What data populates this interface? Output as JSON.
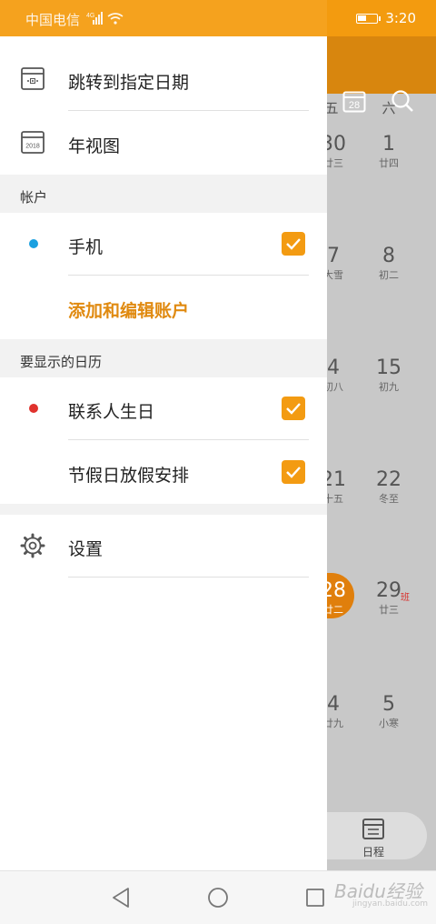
{
  "status_bar": {
    "carrier": "中国电信",
    "signal": "4G",
    "time": "3:20"
  },
  "calendar": {
    "weekdays": [
      "五",
      "六"
    ],
    "cells": [
      {
        "num": "30",
        "lunar": "廿三"
      },
      {
        "num": "1",
        "lunar": "廿四"
      },
      {
        "num": "7",
        "lunar": "大雪"
      },
      {
        "num": "8",
        "lunar": "初二"
      },
      {
        "num": "4",
        "lunar": "初八"
      },
      {
        "num": "15",
        "lunar": "初九"
      },
      {
        "num": "21",
        "lunar": "十五"
      },
      {
        "num": "22",
        "lunar": "冬至"
      },
      {
        "num": "28",
        "lunar": "廿二"
      },
      {
        "num": "29",
        "lunar": "廿三"
      },
      {
        "num": "4",
        "lunar": "廿九"
      },
      {
        "num": "5",
        "lunar": "小寒"
      }
    ],
    "badge": "班",
    "header_date_icon": "28",
    "bottom_tab_label": "日程"
  },
  "drawer": {
    "goto_date": "跳转到指定日期",
    "year_view": "年视图",
    "year_icon_text": "2018",
    "section_accounts": "帐户",
    "account_phone": "手机",
    "add_edit_accounts": "添加和编辑账户",
    "section_calendars": "要显示的日历",
    "cal_birthdays": "联系人生日",
    "cal_holidays": "节假日放假安排",
    "settings": "设置"
  },
  "colors": {
    "accent": "#f39b12",
    "phone_dot": "#1aa0e0",
    "birthday_dot": "#e0322d"
  },
  "watermark": {
    "main": "Baidu经验",
    "sub": "jingyan.baidu.com"
  },
  "icons": [
    "calendar-goto-icon",
    "year-view-icon",
    "gear-icon",
    "search-icon",
    "calendar-today-icon",
    "back-icon",
    "home-icon",
    "recents-icon"
  ]
}
